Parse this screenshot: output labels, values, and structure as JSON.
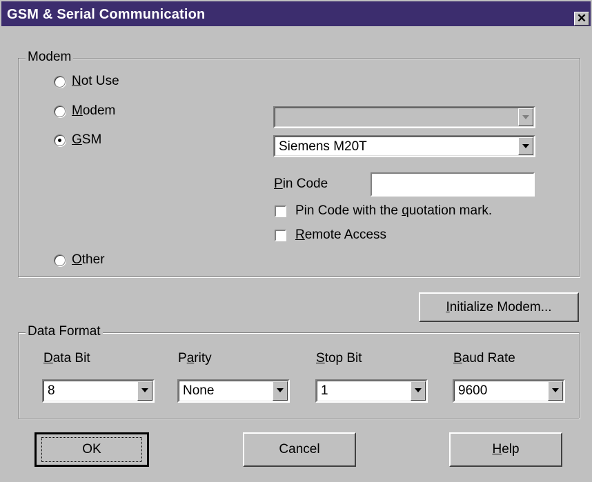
{
  "window": {
    "title": "GSM & Serial Communication",
    "close_label": "✕"
  },
  "modem": {
    "group_label": "Modem",
    "options": [
      {
        "label": "Not Use",
        "mnemonic": "N",
        "rest": "ot Use",
        "checked": false
      },
      {
        "label": "Modem",
        "mnemonic": "M",
        "rest": "odem",
        "checked": false
      },
      {
        "label": "GSM",
        "mnemonic": "G",
        "rest": "SM",
        "checked": true
      },
      {
        "label": "Other",
        "mnemonic": "O",
        "rest": "ther",
        "checked": false
      }
    ],
    "modem_combo_value": "",
    "gsm_combo_value": "Siemens M20T",
    "pin_code": {
      "label_mnemonic": "P",
      "label_rest": "in Code",
      "value": ""
    },
    "pin_quotation": {
      "label_pre": "Pin Code with the ",
      "mnemonic": "q",
      "label_post": "uotation mark.",
      "checked": false
    },
    "remote_access": {
      "mnemonic": "R",
      "label_rest": "emote Access",
      "checked": false
    }
  },
  "initialize_button": {
    "mnemonic": "I",
    "rest": "nitialize Modem..."
  },
  "data_format": {
    "group_label": "Data Format",
    "fields": [
      {
        "pre": "",
        "mnemonic": "D",
        "post": "ata Bit",
        "value": "8"
      },
      {
        "pre": "P",
        "mnemonic": "a",
        "post": "rity",
        "value": "None"
      },
      {
        "pre": "",
        "mnemonic": "S",
        "post": "top Bit",
        "value": "1"
      },
      {
        "pre": "",
        "mnemonic": "B",
        "post": "aud Rate",
        "value": "9600"
      }
    ]
  },
  "buttons": {
    "ok": "OK",
    "cancel": "Cancel",
    "help_mnemonic": "H",
    "help_rest": "elp"
  }
}
